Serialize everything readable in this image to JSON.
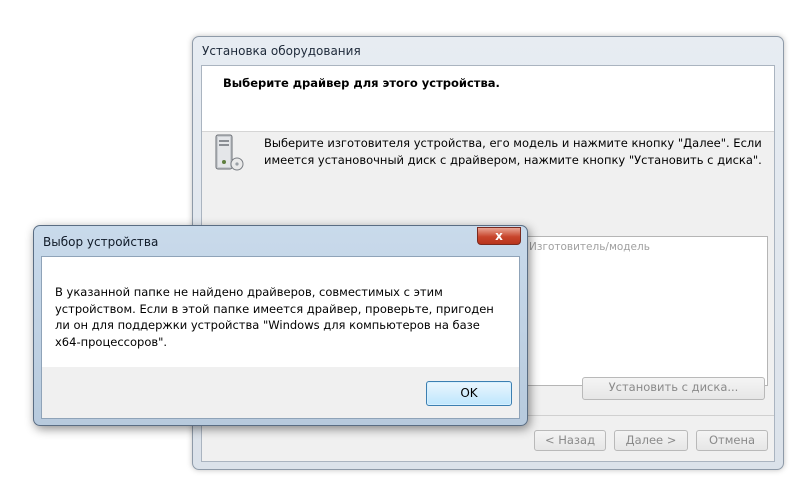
{
  "wizard": {
    "title": "Установка оборудования",
    "heading": "Выберите драйвер для этого устройства.",
    "description": "Выберите изготовителя устройства, его модель и нажмите кнопку \"Далее\". Если имеется установочный диск с драйвером, нажмите кнопку \"Установить с диска\".",
    "manufacturer_header": "Изготовитель/модель",
    "have_disk_label": "Установить с диска...",
    "back_label": "< Назад",
    "next_label": "Далее >",
    "cancel_label": "Отмена",
    "icon": "hardware-device-icon"
  },
  "dialog": {
    "title": "Выбор устройства",
    "close_label": "x",
    "message": "В указанной папке не найдено драйверов, совместимых с этим устройством. Если в этой папке имеется драйвер, проверьте, пригоден ли он для поддержки устройства \"Windows для компьютеров на базе x64-процессоров\".",
    "ok_label": "OK"
  }
}
